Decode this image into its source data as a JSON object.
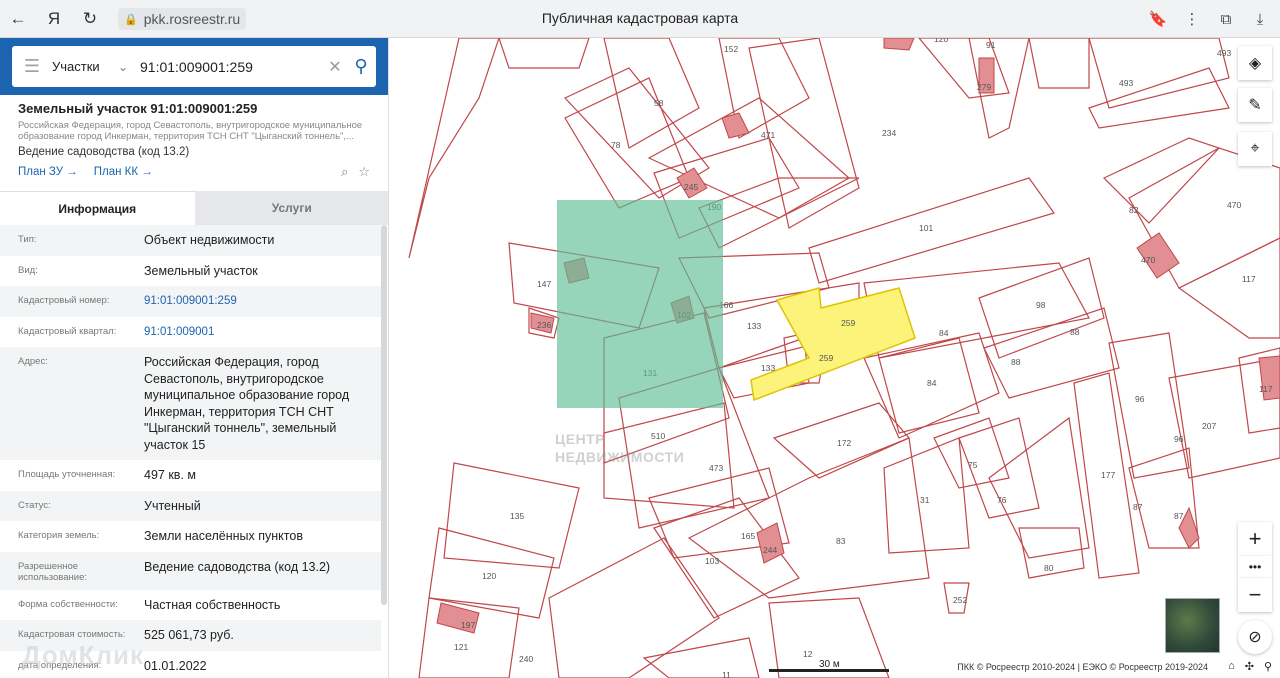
{
  "browser": {
    "address": "pkk.rosreestr.ru",
    "title": "Публичная кадастровая карта",
    "back_icon": "←",
    "yandex_icon": "Я",
    "reload_icon": "↻",
    "bookmark_icon": "🔖",
    "menu_icon": "⋮",
    "tool1_icon": "⧉",
    "download_icon": "⤓"
  },
  "search": {
    "type": "Участки",
    "value": "91:01:009001:259",
    "collapse": "‹"
  },
  "object": {
    "title": "Земельный участок 91:01:009001:259",
    "subtitle": "Российская Федерация, город Севастополь, внутригородское муниципальное образование город Инкерман, территория ТСН СНТ \"Цыганский тоннель\",...",
    "use": "Ведение садоводства (код 13.2)",
    "plan_zu": "План ЗУ →",
    "plan_kk": "План КК →"
  },
  "tabs": {
    "info": "Информация",
    "services": "Услуги"
  },
  "info_rows": [
    {
      "key": "Тип:",
      "value": "Объект недвижимости"
    },
    {
      "key": "Вид:",
      "value": "Земельный участок"
    },
    {
      "key": "Кадастровый номер:",
      "value": "91:01:009001:259"
    },
    {
      "key": "Кадастровый квартал:",
      "value": "91:01:009001"
    },
    {
      "key": "Адрес:",
      "value": "Российская Федерация, город Севастополь, внутригородское муниципальное образование город Инкерман, территория ТСН СНТ \"Цыганский тоннель\", земельный участок 15"
    },
    {
      "key": "Площадь уточненная:",
      "value": "497 кв. м"
    },
    {
      "key": "Статус:",
      "value": "Учтенный"
    },
    {
      "key": "Категория земель:",
      "value": "Земли населённых пунктов"
    },
    {
      "key": "Разрешенное использование:",
      "value": "Ведение садоводства (код 13.2)"
    },
    {
      "key": "Форма собственности:",
      "value": "Частная собственность"
    },
    {
      "key": "Кадастровая стоимость:",
      "value": "525 061,73 руб."
    },
    {
      "key": "дата определения:",
      "value": "01.01.2022"
    }
  ],
  "watermarks": {
    "domclick": "ДомКлик",
    "center_line1": "ЦЕНТР",
    "center_line2": "НЕДВИЖИМОСТИ"
  },
  "map": {
    "scale": "30 м",
    "copyright": "ПКК © Росреестр 2010-2024 | ЕЭКО © Росреестр 2019-2024",
    "labels": [
      "152",
      "120",
      "91",
      "493",
      "58",
      "471",
      "234",
      "279",
      "493",
      "78",
      "245",
      "190",
      "101",
      "82",
      "470",
      "147",
      "166",
      "133",
      "259",
      "259",
      "98",
      "117",
      "470",
      "236",
      "102",
      "131",
      "133",
      "84",
      "88",
      "88",
      "510",
      "172",
      "84",
      "96",
      "117",
      "473",
      "75",
      "207",
      "135",
      "31",
      "76",
      "177",
      "96",
      "87",
      "87",
      "165",
      "244",
      "83",
      "103",
      "80",
      "120",
      "252",
      "197",
      "121",
      "240",
      "12",
      "11"
    ]
  }
}
